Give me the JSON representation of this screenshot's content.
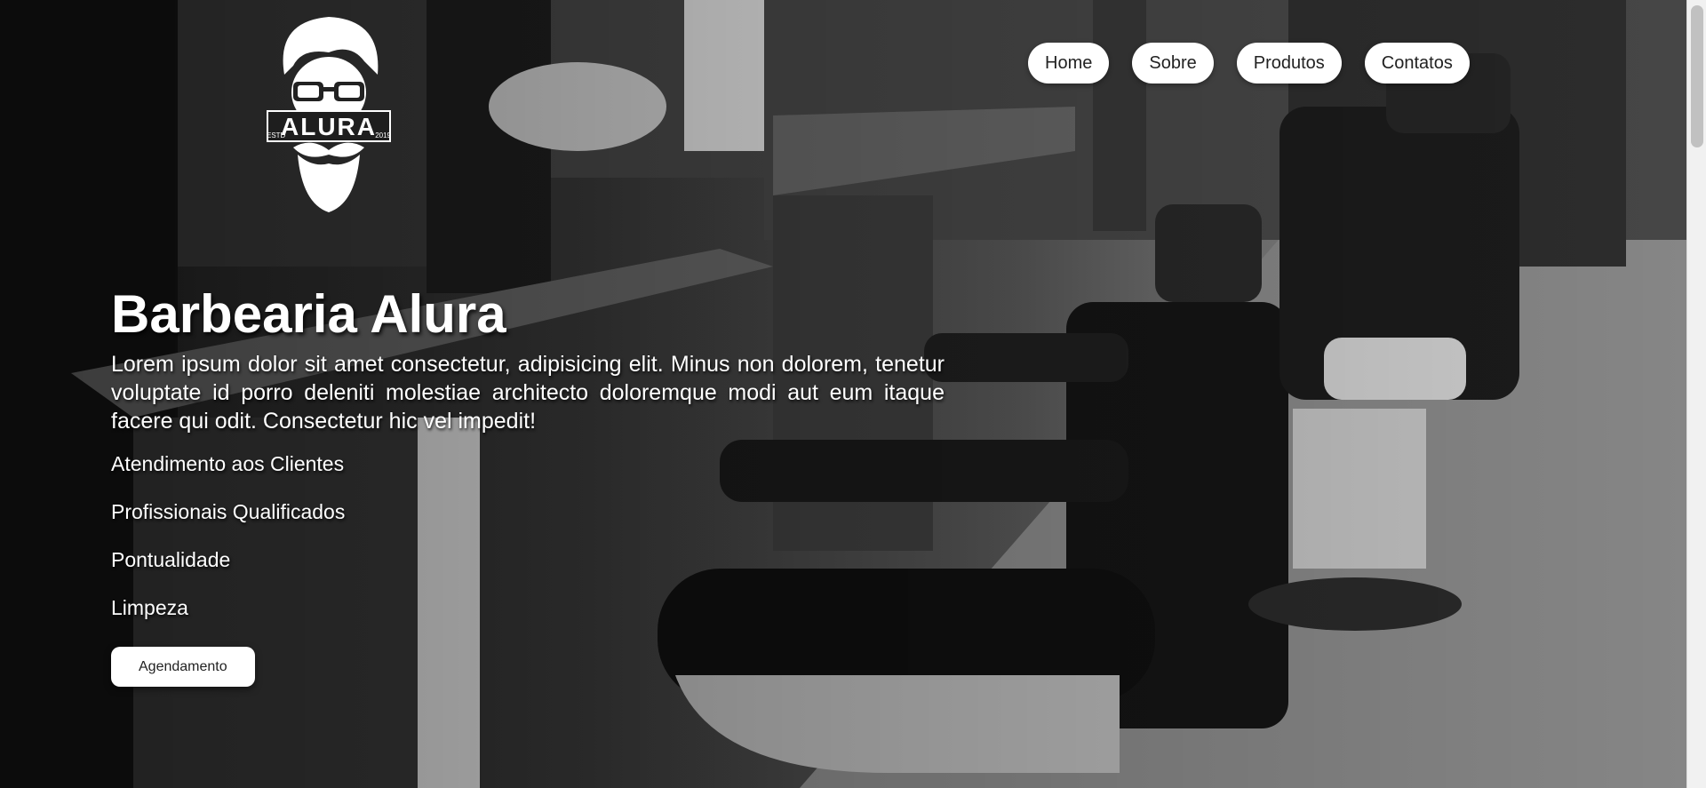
{
  "logo": {
    "brand": "ALURA",
    "estd": "ESTD",
    "year": "2019"
  },
  "nav": {
    "items": [
      {
        "label": "Home"
      },
      {
        "label": "Sobre"
      },
      {
        "label": "Produtos"
      },
      {
        "label": "Contatos"
      }
    ]
  },
  "hero": {
    "title": "Barbearia Alura",
    "description": "Lorem ipsum dolor sit amet consectetur, adipisicing elit. Minus non dolorem, tenetur voluptate id porro deleniti molestiae architecto doloremque modi aut eum itaque facere qui odit. Consectetur hic vel impedit!",
    "features": [
      "Atendimento aos Clientes",
      "Profissionais Qualificados",
      "Pontualidade",
      "Limpeza"
    ],
    "cta_label": "Agendamento"
  }
}
